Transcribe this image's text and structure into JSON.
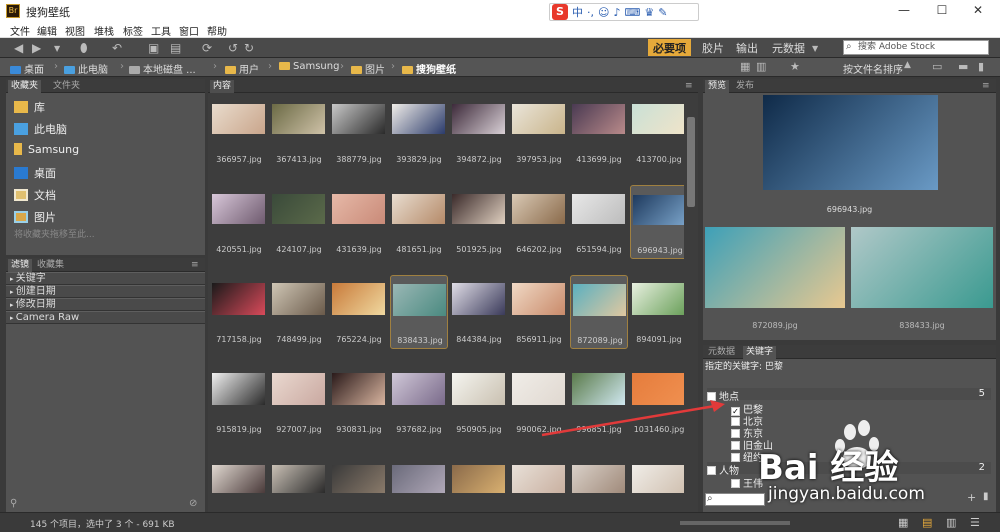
{
  "title": "搜狗壁纸",
  "menu": [
    "文件",
    "编辑",
    "视图",
    "堆栈",
    "标签",
    "工具",
    "窗口",
    "帮助"
  ],
  "ime": {
    "logo": "S",
    "mode": "中"
  },
  "toolbar": {
    "workspaces": [
      "必要项",
      "胶片",
      "输出",
      "元数据"
    ],
    "search_placeholder": "搜索 Adobe Stock",
    "sort_label": "按文件名排序"
  },
  "breadcrumb": [
    "桌面",
    "此电脑",
    "本地磁盘 ...",
    "用户",
    "Samsung",
    "图片",
    "搜狗壁纸"
  ],
  "left_tabs": [
    "收藏夹",
    "文件夹"
  ],
  "favorites": [
    {
      "label": "库",
      "icon": "folder-icon"
    },
    {
      "label": "此电脑",
      "icon": "computer-icon"
    },
    {
      "label": "Samsung",
      "icon": "folder-icon"
    },
    {
      "label": "桌面",
      "icon": "desktop-icon"
    },
    {
      "label": "文档",
      "icon": "document-icon"
    },
    {
      "label": "图片",
      "icon": "pictures-icon"
    }
  ],
  "favorites_hint": "将收藏夹拖移至此...",
  "filter_tabs": [
    "滤镜",
    "收藏集"
  ],
  "filters": [
    "关键字",
    "创建日期",
    "修改日期",
    "Camera Raw"
  ],
  "content_tab": "内容",
  "thumbnails": [
    {
      "name": "366957.jpg",
      "colors": [
        "#e9dccd",
        "#c9a58b"
      ],
      "selected": false
    },
    {
      "name": "367413.jpg",
      "colors": [
        "#6b6a45",
        "#cfc2a8"
      ],
      "selected": false
    },
    {
      "name": "388779.jpg",
      "colors": [
        "#c8c8c8",
        "#2a2a2a"
      ],
      "selected": false
    },
    {
      "name": "393829.jpg",
      "colors": [
        "#f0ede8",
        "#2b3b6b"
      ],
      "selected": false
    },
    {
      "name": "394872.jpg",
      "colors": [
        "#3d2a3a",
        "#d9d0d6"
      ],
      "selected": false
    },
    {
      "name": "397953.jpg",
      "colors": [
        "#eae5da",
        "#c9b48a"
      ],
      "selected": false
    },
    {
      "name": "413699.jpg",
      "colors": [
        "#4a3a52",
        "#b98a8a"
      ],
      "selected": false
    },
    {
      "name": "413700.jpg",
      "colors": [
        "#c9e0d6",
        "#f0e4c9"
      ],
      "selected": false
    },
    {
      "name": "420551.jpg",
      "colors": [
        "#d8c7d9",
        "#6e5a6e"
      ],
      "selected": false
    },
    {
      "name": "424107.jpg",
      "colors": [
        "#3a4a3a",
        "#5b6a4a"
      ],
      "selected": false
    },
    {
      "name": "431639.jpg",
      "colors": [
        "#e6b9a8",
        "#c98a78"
      ],
      "selected": false
    },
    {
      "name": "481651.jpg",
      "colors": [
        "#e8ddd0",
        "#b58a68"
      ],
      "selected": false
    },
    {
      "name": "501925.jpg",
      "colors": [
        "#3a2a2a",
        "#e0d0c0"
      ],
      "selected": false
    },
    {
      "name": "646202.jpg",
      "colors": [
        "#d9c9b5",
        "#8a6a4a"
      ],
      "selected": false
    },
    {
      "name": "651594.jpg",
      "colors": [
        "#e8e8e8",
        "#bcbcbc"
      ],
      "selected": false
    },
    {
      "name": "696943.jpg",
      "colors": [
        "#1e3a5e",
        "#7aa3c9"
      ],
      "selected": true
    },
    {
      "name": "717158.jpg",
      "colors": [
        "#1a1a1a",
        "#d94a5a"
      ],
      "selected": false
    },
    {
      "name": "748499.jpg",
      "colors": [
        "#cfc6b5",
        "#6a5a4a"
      ],
      "selected": false
    },
    {
      "name": "765224.jpg",
      "colors": [
        "#c87a3a",
        "#f0d9a0"
      ],
      "selected": false
    },
    {
      "name": "838433.jpg",
      "colors": [
        "#9ab7b5",
        "#4a8a80"
      ],
      "selected": true
    },
    {
      "name": "844384.jpg",
      "colors": [
        "#e0dde6",
        "#3a3a5a"
      ],
      "selected": false
    },
    {
      "name": "856911.jpg",
      "colors": [
        "#f0d9c5",
        "#c98a6a"
      ],
      "selected": false
    },
    {
      "name": "872089.jpg",
      "colors": [
        "#5bb0c0",
        "#e0c8a0"
      ],
      "selected": true
    },
    {
      "name": "894091.jpg",
      "colors": [
        "#e8f0e0",
        "#6aa05a"
      ],
      "selected": false
    },
    {
      "name": "915819.jpg",
      "colors": [
        "#f0f0f0",
        "#2a2a2a"
      ],
      "selected": false
    },
    {
      "name": "927007.jpg",
      "colors": [
        "#ead9d0",
        "#c9a8a0"
      ],
      "selected": false
    },
    {
      "name": "930831.jpg",
      "colors": [
        "#2a1a1a",
        "#d9b5a0"
      ],
      "selected": false
    },
    {
      "name": "937682.jpg",
      "colors": [
        "#d0c8d8",
        "#7a6a8a"
      ],
      "selected": false
    },
    {
      "name": "950905.jpg",
      "colors": [
        "#f5f5f0",
        "#c9c0b0"
      ],
      "selected": false
    },
    {
      "name": "990062.jpg",
      "colors": [
        "#f0ede8",
        "#e0d8d0"
      ],
      "selected": false
    },
    {
      "name": "996851.jpg",
      "colors": [
        "#5a7a4a",
        "#d0e8f0"
      ],
      "selected": false
    },
    {
      "name": "1031460.jpg",
      "colors": [
        "#e57c3c",
        "#f09050"
      ],
      "selected": false
    },
    {
      "name": "",
      "colors": [
        "#e0d8d0",
        "#4a3a3a"
      ],
      "selected": false
    },
    {
      "name": "",
      "colors": [
        "#c9c0b5",
        "#2a2a2a"
      ],
      "selected": false
    },
    {
      "name": "",
      "colors": [
        "#3a3a3a",
        "#8a7a6a"
      ],
      "selected": false
    },
    {
      "name": "",
      "colors": [
        "#6a6a7a",
        "#b0a8b8"
      ],
      "selected": false
    },
    {
      "name": "",
      "colors": [
        "#8a6a4a",
        "#d9b070"
      ],
      "selected": false
    },
    {
      "name": "",
      "colors": [
        "#e8e0d8",
        "#c9b0a0"
      ],
      "selected": false
    },
    {
      "name": "",
      "colors": [
        "#d9d0c8",
        "#a08a7a"
      ],
      "selected": false
    },
    {
      "name": "",
      "colors": [
        "#f0ede8",
        "#d0c0b0"
      ],
      "selected": false
    }
  ],
  "preview_tabs": [
    "预览",
    "发布"
  ],
  "previews": [
    {
      "name": "696943.jpg",
      "colors": [
        "#0f2a48",
        "#6a9ac5"
      ]
    },
    {
      "name": "872089.jpg",
      "colors": [
        "#3da0b8",
        "#e8c890"
      ]
    },
    {
      "name": "838433.jpg",
      "colors": [
        "#b0c8c8",
        "#3a9a90"
      ]
    }
  ],
  "meta_tabs": [
    "元数据",
    "关键字"
  ],
  "assigned_keywords": "指定的关键字: 巴黎",
  "keyword_groups": [
    {
      "label": "地点",
      "count": "5",
      "items": [
        {
          "label": "巴黎",
          "checked": true
        },
        {
          "label": "北京",
          "checked": false
        },
        {
          "label": "东京",
          "checked": false
        },
        {
          "label": "旧金山",
          "checked": false
        },
        {
          "label": "纽约",
          "checked": false
        }
      ]
    },
    {
      "label": "人物",
      "count": "2",
      "items": [
        {
          "label": "王伟",
          "checked": false
        }
      ]
    }
  ],
  "status_text": "145 个项目，选中了 3 个 - 691 KB",
  "watermark": {
    "brand": "Bai 经验",
    "url": "jingyan.baidu.com"
  },
  "colors": {
    "accent": "#e5a93a",
    "arrow": "#e23a3a"
  }
}
